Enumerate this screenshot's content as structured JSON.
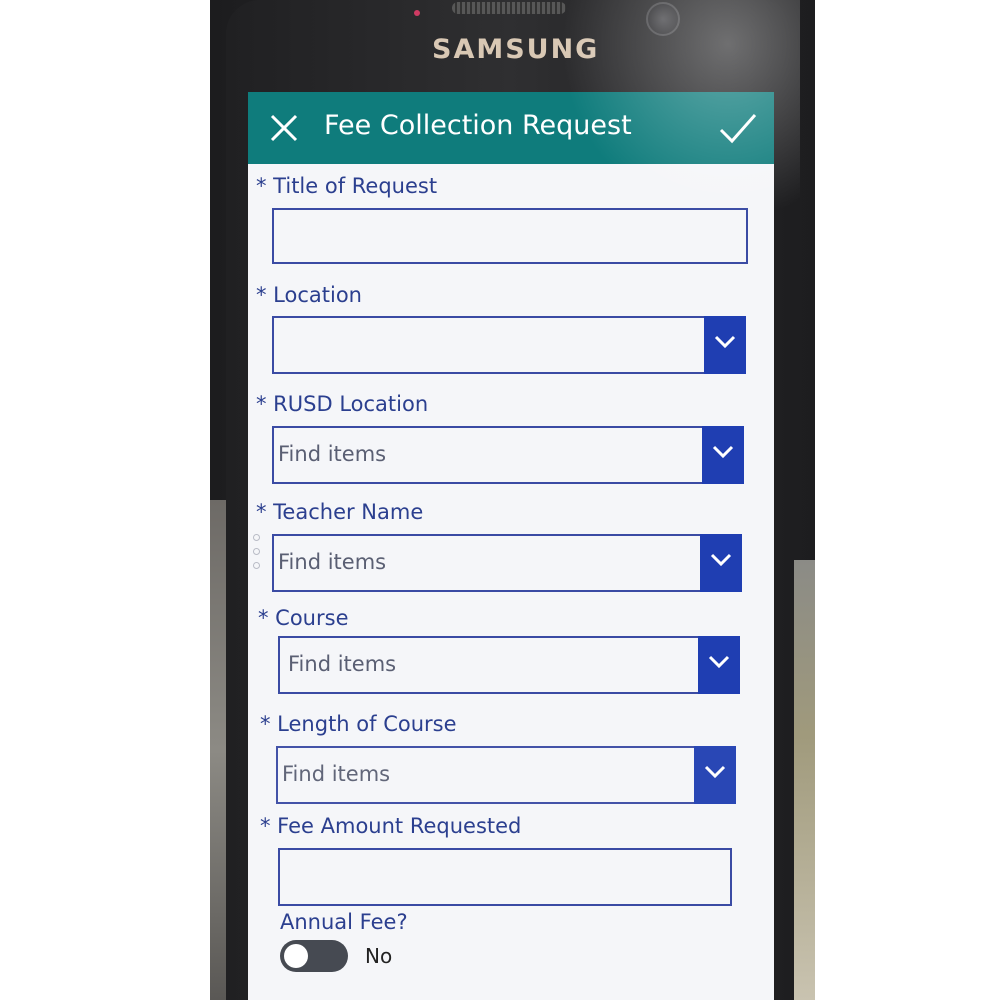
{
  "device": {
    "brand": "SAMSUNG"
  },
  "appbar": {
    "title": "Fee Collection Request"
  },
  "form": {
    "title_of_request": {
      "label": "* Title of Request",
      "value": ""
    },
    "location": {
      "label": "* Location",
      "value": ""
    },
    "rusd_location": {
      "label": "* RUSD Location",
      "placeholder": "Find items"
    },
    "teacher_name": {
      "label": "* Teacher Name",
      "placeholder": "Find items"
    },
    "course": {
      "label": "* Course",
      "placeholder": "Find items"
    },
    "length_of_course": {
      "label": "* Length of Course",
      "placeholder": "Find items"
    },
    "fee_amount_requested": {
      "label": "* Fee Amount Requested",
      "value": ""
    },
    "annual_fee": {
      "label": "Annual Fee?",
      "toggle_text": "No",
      "on": false
    }
  },
  "colors": {
    "appbar": "#0f7c7c",
    "label_text": "#2b3f8f",
    "field_border": "#3a4ba4",
    "dropdown_button": "#1f3eb2",
    "toggle_off": "#464a52"
  },
  "icons": [
    "close-icon",
    "checkmark-icon",
    "chevron-down-icon"
  ]
}
